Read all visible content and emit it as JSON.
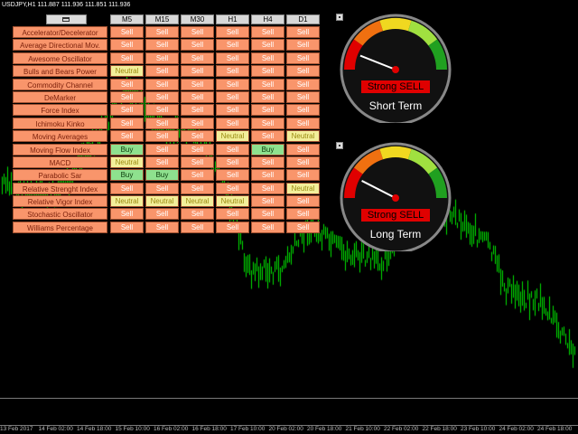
{
  "chart": {
    "symbol_label": "USDJPY,H1  111.887 111.936 111.851 111.936",
    "candle_color": "#00e000",
    "date_ticks": [
      "13 Feb 2017",
      "14 Feb 02:00",
      "14 Feb 18:00",
      "15 Feb 10:00",
      "16 Feb 02:00",
      "16 Feb 18:00",
      "17 Feb 10:00",
      "20 Feb 02:00",
      "20 Feb 18:00",
      "21 Feb 10:00",
      "22 Feb 02:00",
      "22 Feb 18:00",
      "23 Feb 10:00",
      "24 Feb 02:00",
      "24 Feb 18:00"
    ]
  },
  "table": {
    "timeframes": [
      "M5",
      "M15",
      "M30",
      "H1",
      "H4",
      "D1"
    ],
    "rows": [
      {
        "name": "Accelerator/Decelerator",
        "signals": [
          "Sell",
          "Sell",
          "Sell",
          "Sell",
          "Sell",
          "Sell"
        ]
      },
      {
        "name": "Average Directional Mov.",
        "signals": [
          "Sell",
          "Sell",
          "Sell",
          "Sell",
          "Sell",
          "Sell"
        ]
      },
      {
        "name": "Awesome Oscillator",
        "signals": [
          "Sell",
          "Sell",
          "Sell",
          "Sell",
          "Sell",
          "Sell"
        ]
      },
      {
        "name": "Bulls and Bears Power",
        "signals": [
          "Neutral",
          "Sell",
          "Sell",
          "Sell",
          "Sell",
          "Sell"
        ]
      },
      {
        "name": "Commodity Channel",
        "signals": [
          "Sell",
          "Sell",
          "Sell",
          "Sell",
          "Sell",
          "Sell"
        ]
      },
      {
        "name": "DeMarker",
        "signals": [
          "Sell",
          "Sell",
          "Sell",
          "Sell",
          "Sell",
          "Sell"
        ]
      },
      {
        "name": "Force Index",
        "signals": [
          "Sell",
          "Sell",
          "Sell",
          "Sell",
          "Sell",
          "Sell"
        ]
      },
      {
        "name": "Ichimoku Kinko",
        "signals": [
          "Sell",
          "Sell",
          "Sell",
          "Sell",
          "Sell",
          "Sell"
        ]
      },
      {
        "name": "Moving Averages",
        "signals": [
          "Sell",
          "Sell",
          "Sell",
          "Neutral",
          "Sell",
          "Neutral"
        ]
      },
      {
        "name": "Moving Flow Index",
        "signals": [
          "Buy",
          "Sell",
          "Sell",
          "Sell",
          "Buy",
          "Sell"
        ]
      },
      {
        "name": "MACD",
        "signals": [
          "Neutral",
          "Sell",
          "Sell",
          "Sell",
          "Sell",
          "Sell"
        ]
      },
      {
        "name": "Parabolic Sar",
        "signals": [
          "Buy",
          "Buy",
          "Sell",
          "Sell",
          "Sell",
          "Sell"
        ]
      },
      {
        "name": "Relative Strenght Index",
        "signals": [
          "Sell",
          "Sell",
          "Sell",
          "Sell",
          "Sell",
          "Neutral"
        ]
      },
      {
        "name": "Relative Vigor Index",
        "signals": [
          "Neutral",
          "Neutral",
          "Neutral",
          "Neutral",
          "Sell",
          "Sell"
        ]
      },
      {
        "name": "Stochastic Oscillator",
        "signals": [
          "Sell",
          "Sell",
          "Sell",
          "Sell",
          "Sell",
          "Sell"
        ]
      },
      {
        "name": "Williams Percentage",
        "signals": [
          "Sell",
          "Sell",
          "Sell",
          "Sell",
          "Sell",
          "Sell"
        ]
      }
    ]
  },
  "gauges": [
    {
      "status": "Strong SELL",
      "term": "Short Term",
      "needle_level": 0.12
    },
    {
      "status": "Strong SELL",
      "term": "Long Term",
      "needle_level": 0.15
    }
  ],
  "colors": {
    "sell": "#f9956b",
    "buy": "#8ee18e",
    "neutral": "#f3ef9a",
    "gauge_red": "#e00000",
    "gauge_orange": "#f07010",
    "gauge_yellow": "#f0d820",
    "gauge_lightgreen": "#a0e040",
    "gauge_green": "#20a020"
  }
}
